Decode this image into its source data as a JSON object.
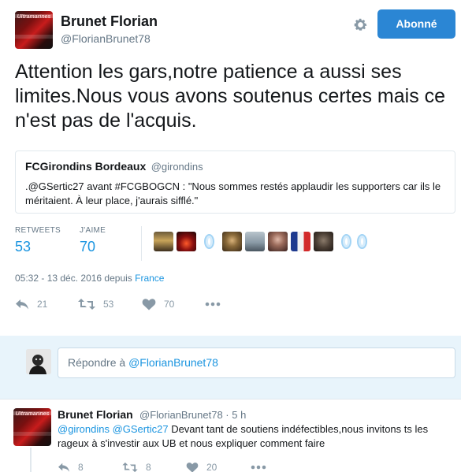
{
  "tweet": {
    "author_name": "Brunet Florian",
    "author_handle": "@FlorianBrunet78",
    "follow_label": "Abonné",
    "text": "Attention les gars,notre patience a aussi ses limites.Nous vous avons soutenus certes mais ce n'est pas de l'acquis.",
    "quote": {
      "name": "FCGirondins Bordeaux",
      "handle": "@girondins",
      "text": ".@GSertic27 avant #FCGBOGCN : \"Nous sommes restés applaudir les supporters car ils le méritaient. À leur place, j'aurais sifflé.\""
    },
    "stats": {
      "retweets_label": "RETWEETS",
      "retweets": "53",
      "likes_label": "J'AIME",
      "likes": "70"
    },
    "timestamp": "05:32 - 13 déc. 2016 depuis",
    "country": "France",
    "actions": {
      "replies": "21",
      "retweets": "53",
      "likes": "70"
    }
  },
  "reply_box": {
    "prompt": "Répondre à ",
    "mention": "@FlorianBrunet78"
  },
  "reply_tweet": {
    "author_name": "Brunet Florian",
    "meta": "@FlorianBrunet78 · 5 h",
    "mention1": "@girondins",
    "mention2": "@GSertic27",
    "text": " Devant tant de soutiens indéfectibles,nous invitons ts les rageux à s'investir aux UB et nous expliquer comment faire",
    "actions": {
      "replies": "8",
      "retweets": "8",
      "likes": "20"
    }
  },
  "avatar_text": "Ultramarines",
  "icons": [
    "gear-icon",
    "reply-icon",
    "retweet-icon",
    "heart-icon",
    "more-icon"
  ],
  "colors": {
    "accent": "#1b95e0",
    "follow_button": "#2b86d4",
    "reply_band": "#e8f4fb",
    "muted": "#657786"
  }
}
